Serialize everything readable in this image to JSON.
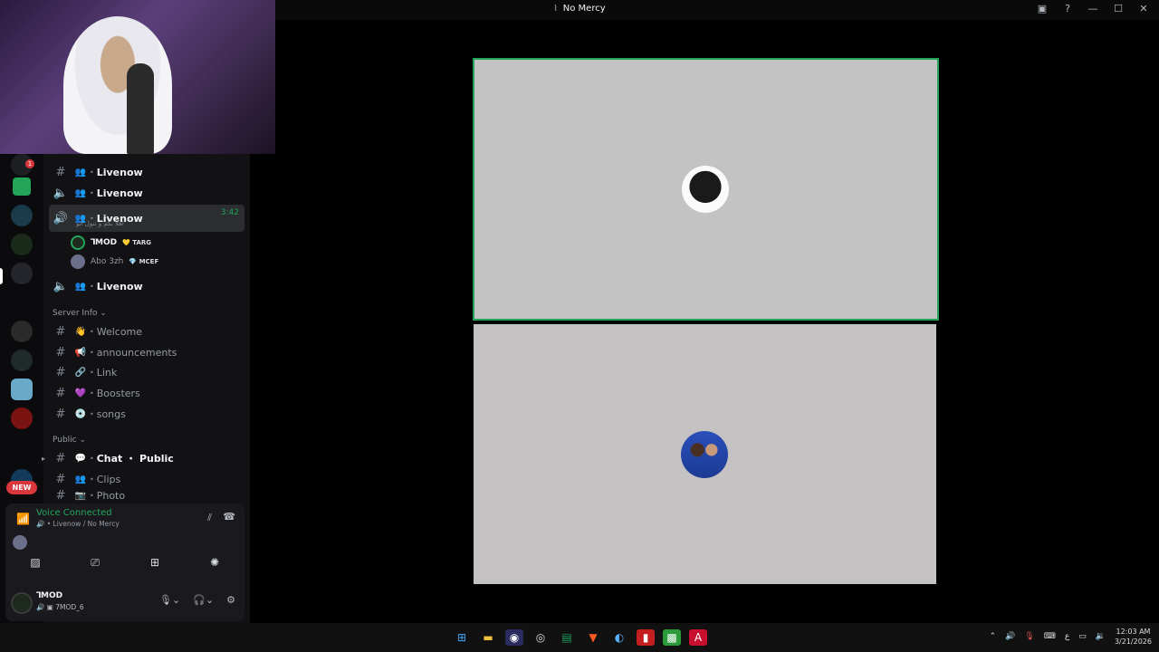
{
  "window": {
    "title": "No Mercy",
    "title_icon": "stage-icon"
  },
  "titlebar_icons": [
    "inbox-icon",
    "help-icon",
    "minimize-icon",
    "maximize-icon",
    "close-icon"
  ],
  "server_rail": {
    "badge_count": "1",
    "new_label": "NEW"
  },
  "channels": [
    {
      "name": "Livenow",
      "type": "voice"
    },
    {
      "name": "Livenow",
      "type": "voice"
    },
    {
      "name": "Livenow",
      "type": "voice",
      "active": true,
      "timer": "3:42",
      "status": "اهلا بكم و ننول ابو"
    },
    {
      "name": "Livenow",
      "type": "voice"
    }
  ],
  "voice_users": [
    {
      "name": "ꓶMOD",
      "tag": "TARG"
    },
    {
      "name": "Abo 3zh",
      "tag": "MCEF"
    }
  ],
  "categories": [
    {
      "label": "Server Info",
      "channels": [
        "Welcome",
        "announcements",
        "Link",
        "Boosters",
        "songs"
      ]
    },
    {
      "label": "Public",
      "channels": [
        "Chat ・ Public",
        "Clips",
        "Photo"
      ]
    }
  ],
  "voice_panel": {
    "status": "Voice Connected",
    "location": "Livenow / No Mercy"
  },
  "user": {
    "name": "ꓶMOD",
    "status": "7MOD_6"
  },
  "taskbar": {
    "time": "12:03 AM",
    "date": "3/21/2026",
    "lang": "ع"
  }
}
